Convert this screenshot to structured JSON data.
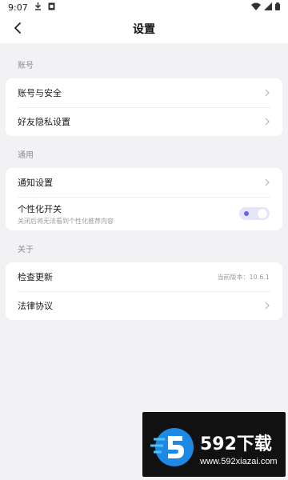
{
  "status_bar": {
    "time": "9:07"
  },
  "header": {
    "title": "设置"
  },
  "sections": [
    {
      "label": "账号",
      "rows": [
        {
          "label": "账号与安全"
        },
        {
          "label": "好友隐私设置"
        }
      ]
    },
    {
      "label": "通用",
      "rows": [
        {
          "label": "通知设置"
        }
      ],
      "toggle_row": {
        "label": "个性化开关",
        "subtitle": "关闭后将无法看到个性化推荐内容",
        "enabled": true
      }
    },
    {
      "label": "关于",
      "rows": [
        {
          "label": "检查更新",
          "value": "当前版本：10.6.1"
        },
        {
          "label": "法律协议"
        }
      ]
    }
  ],
  "watermark": {
    "title": "592下载",
    "url": "www.592xiazai.com"
  },
  "colors": {
    "accent": "#6a63e8",
    "toggle_track": "#e6e6fb",
    "background": "#f2f2f4"
  },
  "icons": [
    "download-icon",
    "sim-icon",
    "wifi-icon",
    "signal-icon",
    "battery-icon",
    "back-arrow-icon",
    "chevron-right-icon"
  ]
}
